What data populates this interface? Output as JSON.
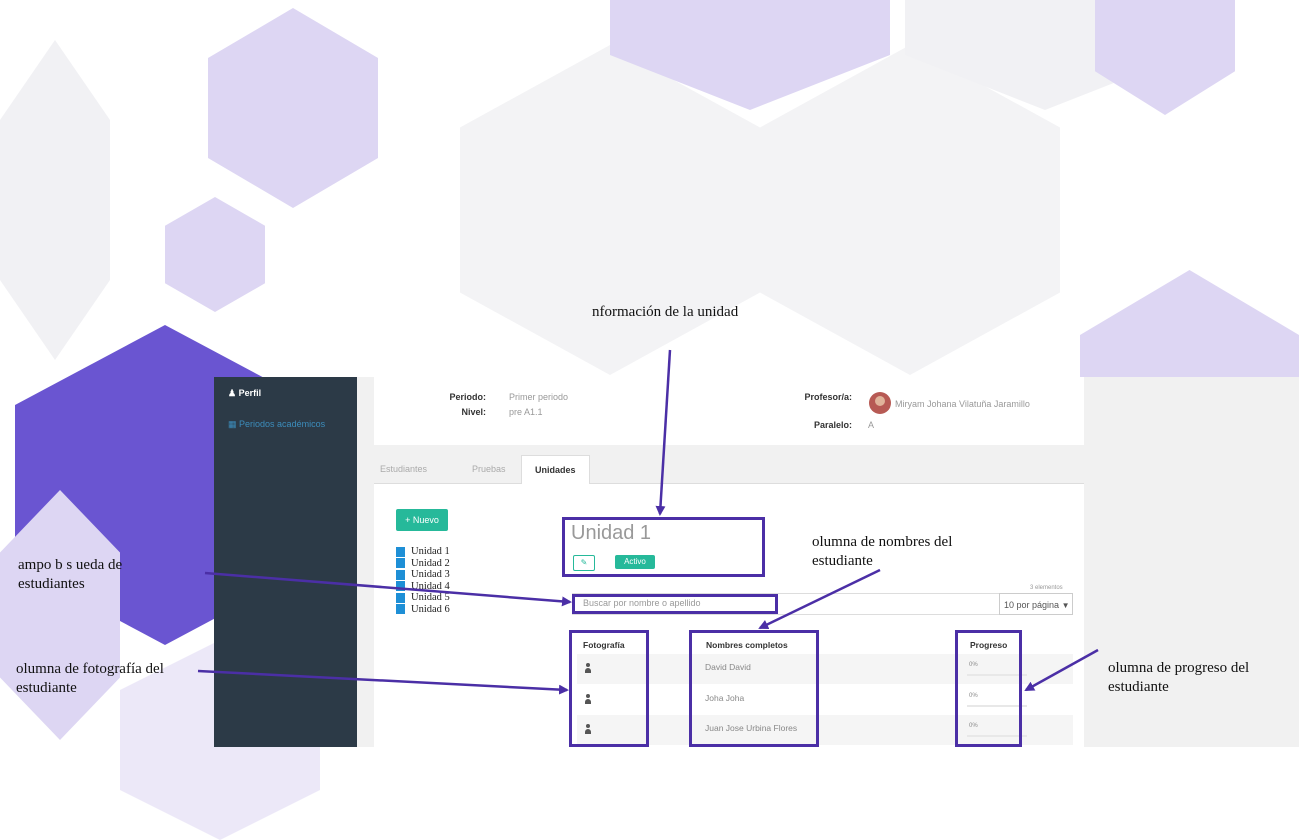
{
  "app": {
    "sidebar": {
      "profile_label": "Perfil",
      "periods_label": "Periodos académicos"
    },
    "info": {
      "periodo_label": "Periodo:",
      "periodo_value": "Primer periodo",
      "nivel_label": "Nivel:",
      "nivel_value": "pre A1.1",
      "profesor_label": "Profesor/a:",
      "profesor_value": "Miryam Johana Vilatuña Jaramillo",
      "paralelo_label": "Paralelo:",
      "paralelo_value": "A"
    },
    "tabs": [
      {
        "label": "Estudiantes",
        "active": false
      },
      {
        "label": "Pruebas",
        "active": false
      },
      {
        "label": "Unidades",
        "active": true
      }
    ],
    "new_button": "+ Nuevo",
    "units": [
      "Unidad 1",
      "Unidad 2",
      "Unidad 3",
      "Unidad 4",
      "Unidad 5",
      "Unidad 6"
    ],
    "selected_unit": {
      "title": "Unidad 1",
      "status": "Activo"
    },
    "search": {
      "placeholder": "Buscar por nombre o apellido"
    },
    "element_count": "3 elementos",
    "per_page": "10 por página",
    "table": {
      "headers": {
        "photo": "Fotografía",
        "name": "Nombres completos",
        "progress": "Progreso"
      },
      "rows": [
        {
          "name": "David David",
          "progress": "0%",
          "progress_fraction": 0
        },
        {
          "name": "Joha Joha",
          "progress": "0%",
          "progress_fraction": 0
        },
        {
          "name": "Juan Jose Urbina Flores",
          "progress": "0%",
          "progress_fraction": 0
        }
      ]
    }
  },
  "annotations": {
    "unit_info": "nformación de la unidad",
    "names_column": "olumna de nombres del estudiante",
    "search_field": "ampo b s ueda de estudiantes",
    "photo_column": "olumna de fotografía del estudiante",
    "progress_column": "olumna de progreso del estudiante"
  },
  "colors": {
    "annotation_accent": "#4b2fa6",
    "primary_green": "#26b99a",
    "sidebar_bg": "#2c3a47",
    "hex_light": "#e5dff5",
    "hex_dark": "#6a55d1"
  }
}
